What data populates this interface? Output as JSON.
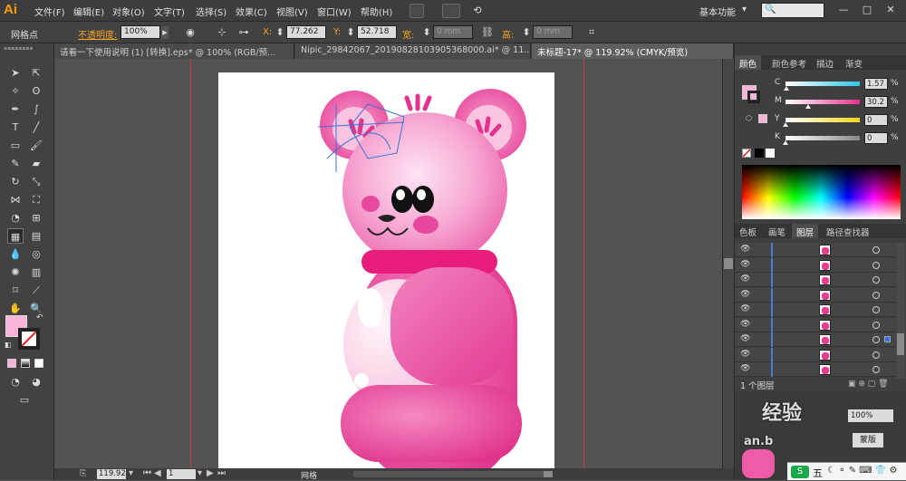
{
  "app": {
    "logo": "Ai"
  },
  "menu": {
    "items": [
      "文件(F)",
      "编辑(E)",
      "对象(O)",
      "文字(T)",
      "选择(S)",
      "效果(C)",
      "视图(V)",
      "窗口(W)",
      "帮助(H)"
    ],
    "workspace": "基本功能"
  },
  "control": {
    "selection_label": "网格点",
    "opacity_label": "不透明度:",
    "opacity_value": "100%",
    "x_label": "X:",
    "x_value": "77.262",
    "y_label": "Y:",
    "y_value": "52.718",
    "w_label": "宽:",
    "w_value": "0 mm",
    "h_label": "高:",
    "h_value": "0 mm"
  },
  "tabs": [
    {
      "label": "请看一下使用说明 (1) [转换].eps* @ 100% (RGB/预...",
      "active": false
    },
    {
      "label": "Nipic_29842067_20190828103905368000.ai* @ 11...",
      "active": false
    },
    {
      "label": "未标题-17* @ 119.92% (CMYK/预览)",
      "active": true
    }
  ],
  "status": {
    "zoom": "119.92",
    "page": "1",
    "tool_label": "网格"
  },
  "color_panel": {
    "tabs": [
      "颜色",
      "颜色参考",
      "描边",
      "渐变"
    ],
    "channels": [
      {
        "label": "C",
        "value": "1.57",
        "fill": 0.0157,
        "color": "#2ec4e6"
      },
      {
        "label": "M",
        "value": "30.2",
        "fill": 0.302,
        "color": "#e6318c"
      },
      {
        "label": "Y",
        "value": "0",
        "fill": 0,
        "color": "#f2d51c"
      },
      {
        "label": "K",
        "value": "0",
        "fill": 0,
        "color": "#888888"
      }
    ],
    "fill_color": "#f7b4d8"
  },
  "layers_panel": {
    "tabs": [
      "色板",
      "画笔",
      "图层",
      "路径查找器"
    ],
    "row_count": 9,
    "footer_label": "1 个图层"
  },
  "overlay_watermark": {
    "main": "经验",
    "sub": "an.b",
    "version": "蒙版",
    "percent": "100%"
  },
  "taskbar": {
    "ime": "五"
  }
}
